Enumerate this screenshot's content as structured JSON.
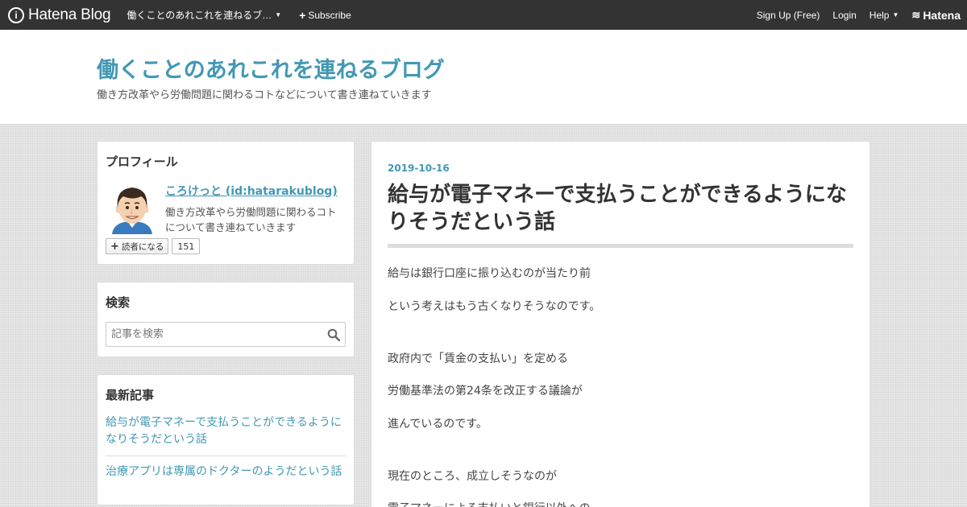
{
  "topbar": {
    "logo_letter": "i",
    "logo_text": "Hatena Blog",
    "blog_dropdown": "働くことのあれこれを連ねるブ…",
    "subscribe": "Subscribe",
    "signup": "Sign Up (Free)",
    "login": "Login",
    "help": "Help",
    "hatena": "Hatena"
  },
  "header": {
    "title": "働くことのあれこれを連ねるブログ",
    "description": "働き方改革やら労働問題に関わるコトなどについて書き連ねていきます"
  },
  "profile": {
    "heading": "プロフィール",
    "name": "ころけっと (id:hatarakublog)",
    "description": "働き方改革やら労働問題に関わるコトについて書き連ねていきます",
    "reader_button": "読者になる",
    "reader_count": "151"
  },
  "search": {
    "heading": "検索",
    "placeholder": "記事を検索"
  },
  "recent": {
    "heading": "最新記事",
    "items": [
      "給与が電子マネーで支払うことができるようになりそうだという話",
      "治療アプリは専属のドクターのようだという話"
    ]
  },
  "article": {
    "date": "2019-10-16",
    "title": "給与が電子マネーで支払うことができるようになりそうだという話",
    "paragraphs": [
      "給与は銀行口座に振り込むのが当たり前",
      "という考えはもう古くなりそうなのです。",
      "政府内で「賃金の支払い」を定める",
      "労働基準法の第24条を改正する議論が",
      "進んでいるのです。",
      "現在のところ、成立しそうなのが",
      "電子マネーによる支払いと銀行以外への"
    ]
  },
  "colors": {
    "accent": "#4298b4",
    "topbar": "#333333"
  }
}
